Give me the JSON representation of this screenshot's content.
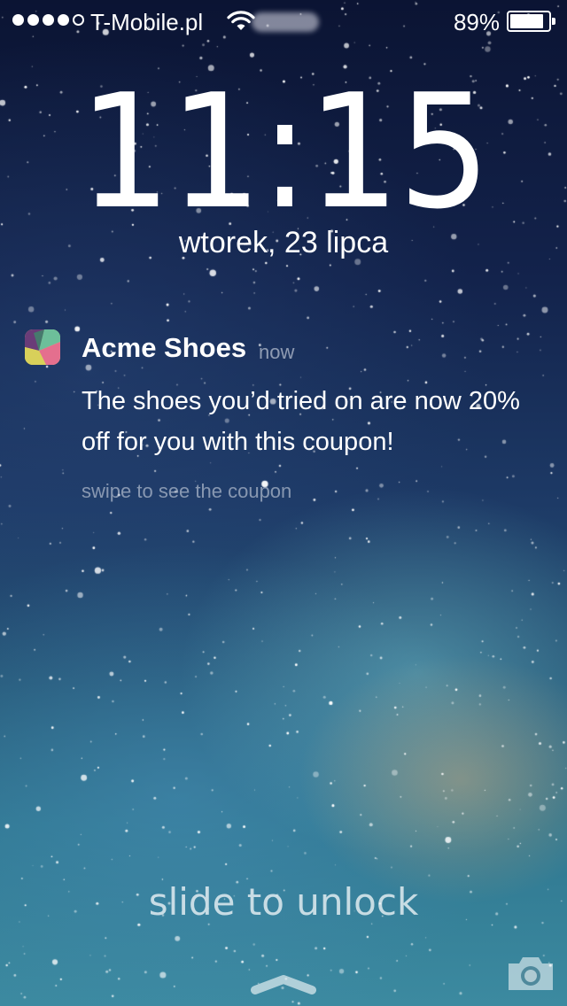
{
  "status_bar": {
    "signal_bars_filled": 4,
    "signal_bars_total": 5,
    "carrier": "T-Mobile.pl",
    "battery_percent_label": "89%",
    "battery_level": 0.89,
    "icons": [
      "signal-dots-icon",
      "wifi-icon",
      "battery-icon"
    ]
  },
  "lock_screen": {
    "time": "11:15",
    "date": "wtorek, 23 lipca"
  },
  "notification": {
    "icon": "acme-shoes-app-icon",
    "app_name": "Acme Shoes",
    "timestamp": "now",
    "message": "The shoes you’d tried on are now 20% off for you with this coupon!",
    "hint": "swipe to see the coupon"
  },
  "bottom": {
    "slide_to_unlock": "slide to unlock",
    "icons": [
      "grabber-chevron-icon",
      "camera-icon"
    ]
  },
  "colors": {
    "sky_top": "#0b1433",
    "sky_bottom": "#3c8aa0",
    "text": "#ffffff"
  }
}
